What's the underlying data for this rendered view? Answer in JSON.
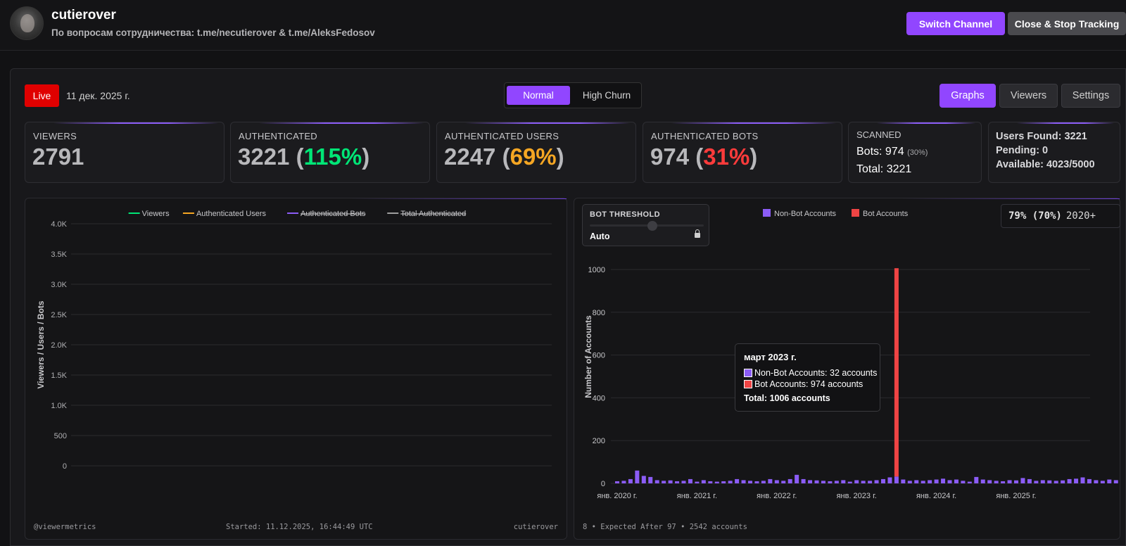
{
  "channel": {
    "name": "cutierover",
    "subtitle": "По вопросам сотрудничества: t.me/necutierover & t.me/AleksFedosov"
  },
  "header_buttons": {
    "switch": "Switch Channel",
    "close": "Close & Stop Tracking"
  },
  "status": {
    "live_label": "Live",
    "date": "11 дек. 2025 г."
  },
  "modes": {
    "normal": "Normal",
    "high_churn": "High Churn",
    "selected": "Normal"
  },
  "tabs": {
    "graphs": "Graphs",
    "viewers": "Viewers",
    "settings": "Settings",
    "selected": "Graphs"
  },
  "stats": {
    "viewers": {
      "label": "VIEWERS",
      "value": "2791"
    },
    "authenticated": {
      "label": "AUTHENTICATED",
      "value": "3221",
      "pct": "115%"
    },
    "auth_users": {
      "label": "AUTHENTICATED USERS",
      "value": "2247",
      "pct": "69%"
    },
    "auth_bots": {
      "label": "AUTHENTICATED BOTS",
      "value": "974",
      "pct": "31%"
    },
    "scanned": {
      "label": "SCANNED",
      "bots": "Bots: 974",
      "bots_pct": "(30%)",
      "total": "Total: 3221"
    },
    "found": {
      "users_found": "Users Found: 3221",
      "pending": "Pending: 0",
      "available": "Available: 4023/5000"
    }
  },
  "colors": {
    "accent": "#9146ff",
    "viewers": "#00e676",
    "users": "#f5a623",
    "bots": "#8b5cf6",
    "total": "#9e9e9e",
    "bot_accounts": "#ef4444"
  },
  "chart_data": [
    {
      "type": "line",
      "title": "",
      "ylabel": "Viewers / Users / Bots",
      "xlabel": "",
      "ylim": [
        0,
        4000
      ],
      "yticks": [
        "0",
        "500",
        "1.0K",
        "1.5K",
        "2.0K",
        "2.5K",
        "3.0K",
        "3.5K",
        "4.0K"
      ],
      "legend": [
        {
          "name": "Viewers",
          "color": "#00e676",
          "hidden": false
        },
        {
          "name": "Authenticated Users",
          "color": "#f5a623",
          "hidden": false
        },
        {
          "name": "Authenticated Bots",
          "color": "#8b5cf6",
          "hidden": true
        },
        {
          "name": "Total Authenticated",
          "color": "#9e9e9e",
          "hidden": true
        }
      ],
      "legend_position": "top-center",
      "series": [],
      "grid": true
    },
    {
      "type": "bar",
      "title": "",
      "ylabel": "Number of Accounts",
      "ylim": [
        0,
        1000
      ],
      "yticks": [
        "0",
        "200",
        "400",
        "600",
        "800",
        "1000"
      ],
      "xticks": [
        "янв. 2020 г.",
        "янв. 2021 г.",
        "янв. 2022 г.",
        "янв. 2023 г.",
        "янв. 2024 г.",
        "янв. 2025 г."
      ],
      "legend": [
        {
          "name": "Non-Bot Accounts",
          "color": "#8b5cf6"
        },
        {
          "name": "Bot Accounts",
          "color": "#ef4444"
        }
      ],
      "legend_position": "top-center",
      "stacked": true,
      "start_month": "2020-01",
      "series": [
        {
          "name": "Non-Bot Accounts",
          "values": [
            10,
            12,
            20,
            60,
            35,
            30,
            15,
            12,
            14,
            10,
            12,
            20,
            8,
            15,
            10,
            8,
            10,
            12,
            20,
            15,
            12,
            10,
            12,
            20,
            15,
            12,
            20,
            40,
            20,
            15,
            14,
            12,
            10,
            12,
            15,
            8,
            15,
            12,
            12,
            15,
            20,
            28,
            32,
            18,
            12,
            15,
            12,
            15,
            18,
            22,
            15,
            18,
            12,
            8,
            30,
            18,
            15,
            12,
            10,
            15,
            14,
            25,
            20,
            12,
            15,
            14,
            12,
            14,
            20,
            22,
            28,
            20,
            15,
            12,
            18,
            15,
            14,
            16,
            30,
            18
          ]
        },
        {
          "name": "Bot Accounts",
          "values": [
            0,
            0,
            0,
            0,
            0,
            0,
            0,
            0,
            0,
            0,
            0,
            0,
            0,
            0,
            0,
            0,
            0,
            0,
            0,
            0,
            0,
            0,
            0,
            0,
            0,
            0,
            0,
            0,
            0,
            0,
            0,
            0,
            0,
            0,
            0,
            0,
            0,
            0,
            0,
            0,
            0,
            0,
            974,
            0,
            0,
            0,
            0,
            0,
            0,
            0,
            0,
            0,
            0,
            0,
            0,
            0,
            0,
            0,
            0,
            0,
            0,
            0,
            0,
            0,
            0,
            0,
            0,
            0,
            0,
            0,
            0,
            0,
            0,
            0,
            0,
            0,
            0,
            0,
            0,
            0
          ]
        }
      ],
      "grid": true
    }
  ],
  "threshold": {
    "label": "BOT THRESHOLD",
    "mode": "Auto",
    "level": 0.55
  },
  "pct_box": {
    "main": "79% (70%)",
    "suffix": "2020+"
  },
  "tooltip": {
    "title": "март 2023 г.",
    "non_bot": "Non-Bot Accounts: 32 accounts",
    "bot": "Bot Accounts: 974 accounts",
    "total": "Total: 1006 accounts"
  },
  "footer_left": {
    "brand": "@viewermetrics",
    "started": "Started: 11.12.2025, 16:44:49 UTC",
    "channel": "cutierover"
  },
  "footer_right": {
    "note": "8 • Expected After 97 • 2542 accounts"
  }
}
